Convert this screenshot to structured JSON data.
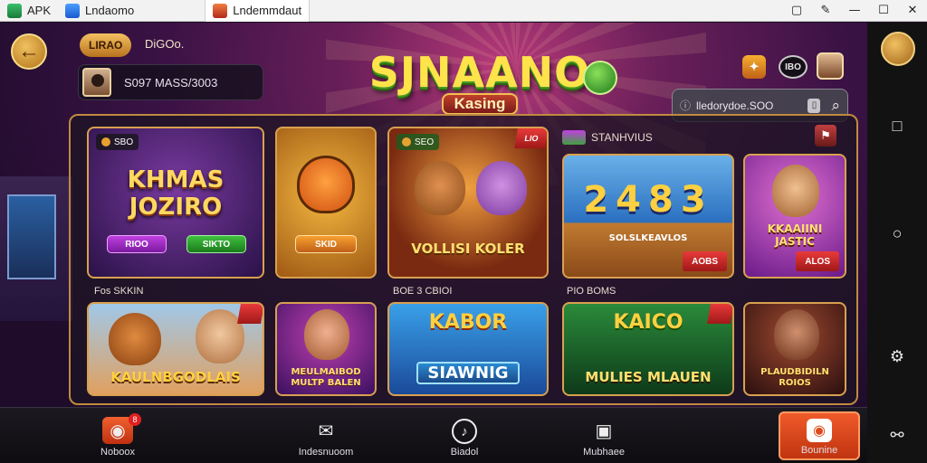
{
  "titlebar": {
    "tabs": [
      {
        "label": "APK"
      },
      {
        "label": "Lndaomo"
      },
      {
        "label": "Lndemmdaut"
      }
    ],
    "controls": [
      "▢",
      "✎",
      "—",
      "☐",
      "✕"
    ]
  },
  "header": {
    "coin_value": "LIRAO",
    "coin_label": "DiGOo.",
    "profile_text": "S097 MASS/3003",
    "logo_main": "SJNAANO",
    "logo_sub": "Kasing",
    "vip_label": "IBO",
    "search_text": "lledorydoe.SOO"
  },
  "rows": [
    {
      "label": "",
      "cards": [
        {
          "tag": "SBO",
          "title": "KHMAS JOZIRO",
          "btn_a": "RIOO",
          "btn_b": "SIKTO"
        },
        {
          "title": "",
          "btn": "SKID"
        },
        {
          "tag": "SEO",
          "title": "VOLLISI KOLER",
          "badge": "LIO"
        },
        {
          "tag": "STANHVIUS",
          "title": "2483",
          "subtitle": "SOLSLKEAVLOS",
          "hot": "AOBS"
        },
        {
          "title": "KKAAIINI JASTIC",
          "hot": "ALOS"
        }
      ]
    },
    {
      "label_left": "Fos SKKIN",
      "label_mid": "BOE 3 CBIOI",
      "label_right": "PIO BOMS",
      "cards": [
        {
          "title": "KAULNBGODLAIS"
        },
        {
          "title": "MEULMAIBOD MULTP BALEN"
        },
        {
          "title_top": "KABOR",
          "title": "SIAWNIG"
        },
        {
          "title_top": "KAICO",
          "title": "MULIES MLAUEN"
        },
        {
          "title": "PLAUDBIDILN ROIOS"
        }
      ]
    }
  ],
  "bottom_nav": [
    {
      "label": "Noboox",
      "icon": "home-icon",
      "badge": "8"
    },
    {
      "label": "Indesnuoom",
      "icon": "mail-icon"
    },
    {
      "label": "Biadol",
      "icon": "music-icon"
    },
    {
      "label": "Mubhaee",
      "icon": "store-icon"
    },
    {
      "label": "Bounine",
      "icon": "bonus-icon"
    }
  ],
  "emulator": {
    "buttons": [
      "□",
      "○",
      "⚙",
      "⚯"
    ]
  },
  "colors": {
    "accent": "#f05a2a",
    "gold": "#d8a050",
    "panel_bg": "#1e1424"
  }
}
